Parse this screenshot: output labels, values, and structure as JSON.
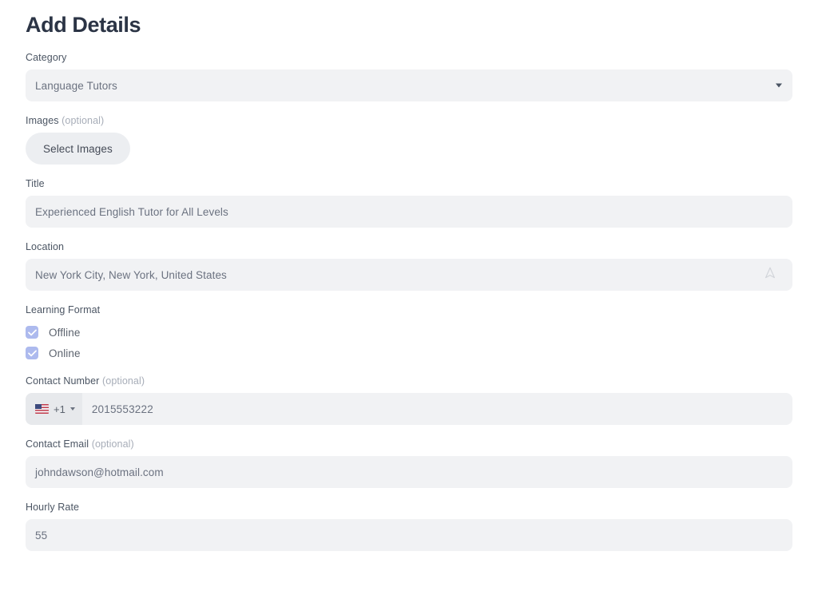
{
  "page": {
    "title": "Add Details"
  },
  "fields": {
    "category": {
      "label": "Category",
      "value": "Language Tutors",
      "icon": "chevron-down-icon"
    },
    "images": {
      "label": "Images",
      "optional": "(optional)",
      "button_label": "Select Images"
    },
    "title": {
      "label": "Title",
      "value": "Experienced English Tutor for All Levels"
    },
    "location": {
      "label": "Location",
      "value": "New York City, New York, United States",
      "icon": "navigation-arrow-icon"
    },
    "learning_format": {
      "label": "Learning Format",
      "options": [
        {
          "label": "Offline",
          "checked": true
        },
        {
          "label": "Online",
          "checked": true
        }
      ]
    },
    "contact_number": {
      "label": "Contact Number",
      "optional": "(optional)",
      "country_flag": "us-flag-icon",
      "country_code": "+1",
      "value": "2015553222"
    },
    "contact_email": {
      "label": "Contact Email",
      "optional": "(optional)",
      "value": "johndawson@hotmail.com"
    },
    "hourly_rate": {
      "label": "Hourly Rate",
      "value": "55"
    }
  },
  "colors": {
    "heading": "#2b3445",
    "field_background": "#f1f2f4",
    "checkbox_accent": "#adbaee",
    "label": "#4b5563",
    "value": "#6b7280"
  }
}
